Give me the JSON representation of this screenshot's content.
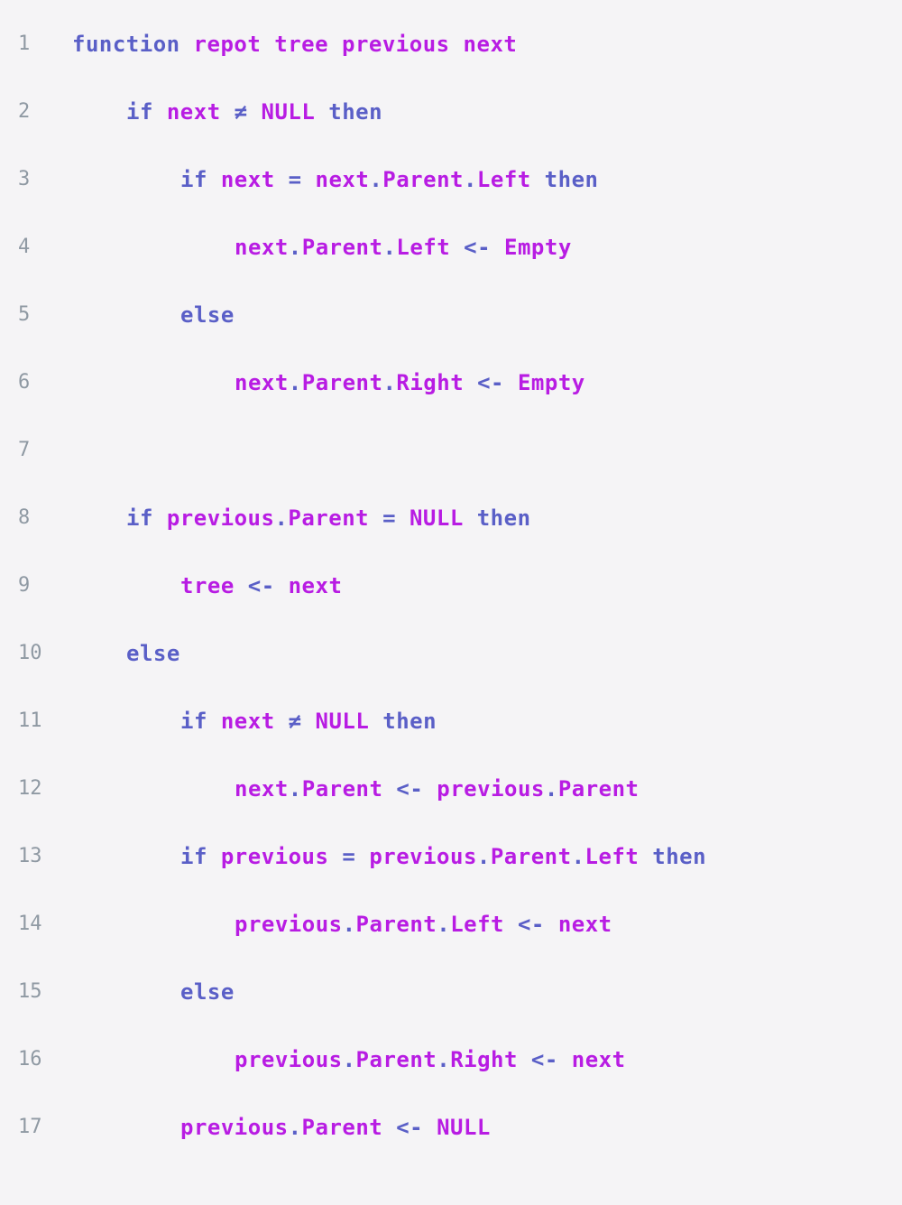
{
  "colors": {
    "background": "#f5f4f6",
    "line_number": "#8f99a3",
    "keyword": "#5a5fc7",
    "identifier": "#b81ce3",
    "operator": "#5a5fc7"
  },
  "code": {
    "lines": [
      {
        "number": "1",
        "indent": 0,
        "tokens": [
          {
            "t": "kw",
            "v": "function"
          },
          {
            "t": "ws",
            "v": " "
          },
          {
            "t": "id",
            "v": "repot"
          },
          {
            "t": "ws",
            "v": " "
          },
          {
            "t": "id",
            "v": "tree"
          },
          {
            "t": "ws",
            "v": " "
          },
          {
            "t": "id",
            "v": "previous"
          },
          {
            "t": "ws",
            "v": " "
          },
          {
            "t": "id",
            "v": "next"
          }
        ]
      },
      {
        "number": "2",
        "indent": 1,
        "tokens": [
          {
            "t": "kw",
            "v": "if"
          },
          {
            "t": "ws",
            "v": " "
          },
          {
            "t": "id",
            "v": "next"
          },
          {
            "t": "ws",
            "v": " "
          },
          {
            "t": "op",
            "v": "≠"
          },
          {
            "t": "ws",
            "v": " "
          },
          {
            "t": "id",
            "v": "NULL"
          },
          {
            "t": "ws",
            "v": " "
          },
          {
            "t": "kw",
            "v": "then"
          }
        ]
      },
      {
        "number": "3",
        "indent": 2,
        "tokens": [
          {
            "t": "kw",
            "v": "if"
          },
          {
            "t": "ws",
            "v": " "
          },
          {
            "t": "id",
            "v": "next"
          },
          {
            "t": "ws",
            "v": " "
          },
          {
            "t": "op",
            "v": "="
          },
          {
            "t": "ws",
            "v": " "
          },
          {
            "t": "id",
            "v": "next"
          },
          {
            "t": "op",
            "v": "."
          },
          {
            "t": "id",
            "v": "Parent"
          },
          {
            "t": "op",
            "v": "."
          },
          {
            "t": "id",
            "v": "Left"
          },
          {
            "t": "ws",
            "v": " "
          },
          {
            "t": "kw",
            "v": "then"
          }
        ]
      },
      {
        "number": "4",
        "indent": 3,
        "tokens": [
          {
            "t": "id",
            "v": "next"
          },
          {
            "t": "op",
            "v": "."
          },
          {
            "t": "id",
            "v": "Parent"
          },
          {
            "t": "op",
            "v": "."
          },
          {
            "t": "id",
            "v": "Left"
          },
          {
            "t": "ws",
            "v": " "
          },
          {
            "t": "op",
            "v": "<-"
          },
          {
            "t": "ws",
            "v": " "
          },
          {
            "t": "id",
            "v": "Empty"
          }
        ]
      },
      {
        "number": "5",
        "indent": 2,
        "tokens": [
          {
            "t": "kw",
            "v": "else"
          }
        ]
      },
      {
        "number": "6",
        "indent": 3,
        "tokens": [
          {
            "t": "id",
            "v": "next"
          },
          {
            "t": "op",
            "v": "."
          },
          {
            "t": "id",
            "v": "Parent"
          },
          {
            "t": "op",
            "v": "."
          },
          {
            "t": "id",
            "v": "Right"
          },
          {
            "t": "ws",
            "v": " "
          },
          {
            "t": "op",
            "v": "<-"
          },
          {
            "t": "ws",
            "v": " "
          },
          {
            "t": "id",
            "v": "Empty"
          }
        ]
      },
      {
        "number": "7",
        "indent": 0,
        "tokens": []
      },
      {
        "number": "8",
        "indent": 1,
        "tokens": [
          {
            "t": "kw",
            "v": "if"
          },
          {
            "t": "ws",
            "v": " "
          },
          {
            "t": "id",
            "v": "previous"
          },
          {
            "t": "op",
            "v": "."
          },
          {
            "t": "id",
            "v": "Parent"
          },
          {
            "t": "ws",
            "v": " "
          },
          {
            "t": "op",
            "v": "="
          },
          {
            "t": "ws",
            "v": " "
          },
          {
            "t": "id",
            "v": "NULL"
          },
          {
            "t": "ws",
            "v": " "
          },
          {
            "t": "kw",
            "v": "then"
          }
        ]
      },
      {
        "number": "9",
        "indent": 2,
        "tokens": [
          {
            "t": "id",
            "v": "tree"
          },
          {
            "t": "ws",
            "v": " "
          },
          {
            "t": "op",
            "v": "<-"
          },
          {
            "t": "ws",
            "v": " "
          },
          {
            "t": "id",
            "v": "next"
          }
        ]
      },
      {
        "number": "10",
        "indent": 1,
        "tokens": [
          {
            "t": "kw",
            "v": "else"
          }
        ]
      },
      {
        "number": "11",
        "indent": 2,
        "tokens": [
          {
            "t": "kw",
            "v": "if"
          },
          {
            "t": "ws",
            "v": " "
          },
          {
            "t": "id",
            "v": "next"
          },
          {
            "t": "ws",
            "v": " "
          },
          {
            "t": "op",
            "v": "≠"
          },
          {
            "t": "ws",
            "v": " "
          },
          {
            "t": "id",
            "v": "NULL"
          },
          {
            "t": "ws",
            "v": " "
          },
          {
            "t": "kw",
            "v": "then"
          }
        ]
      },
      {
        "number": "12",
        "indent": 3,
        "tokens": [
          {
            "t": "id",
            "v": "next"
          },
          {
            "t": "op",
            "v": "."
          },
          {
            "t": "id",
            "v": "Parent"
          },
          {
            "t": "ws",
            "v": " "
          },
          {
            "t": "op",
            "v": "<-"
          },
          {
            "t": "ws",
            "v": " "
          },
          {
            "t": "id",
            "v": "previous"
          },
          {
            "t": "op",
            "v": "."
          },
          {
            "t": "id",
            "v": "Parent"
          }
        ]
      },
      {
        "number": "13",
        "indent": 2,
        "tokens": [
          {
            "t": "kw",
            "v": "if"
          },
          {
            "t": "ws",
            "v": " "
          },
          {
            "t": "id",
            "v": "previous"
          },
          {
            "t": "ws",
            "v": " "
          },
          {
            "t": "op",
            "v": "="
          },
          {
            "t": "ws",
            "v": " "
          },
          {
            "t": "id",
            "v": "previous"
          },
          {
            "t": "op",
            "v": "."
          },
          {
            "t": "id",
            "v": "Parent"
          },
          {
            "t": "op",
            "v": "."
          },
          {
            "t": "id",
            "v": "Left"
          },
          {
            "t": "ws",
            "v": " "
          },
          {
            "t": "kw",
            "v": "then"
          }
        ]
      },
      {
        "number": "14",
        "indent": 3,
        "tokens": [
          {
            "t": "id",
            "v": "previous"
          },
          {
            "t": "op",
            "v": "."
          },
          {
            "t": "id",
            "v": "Parent"
          },
          {
            "t": "op",
            "v": "."
          },
          {
            "t": "id",
            "v": "Left"
          },
          {
            "t": "ws",
            "v": " "
          },
          {
            "t": "op",
            "v": "<-"
          },
          {
            "t": "ws",
            "v": " "
          },
          {
            "t": "id",
            "v": "next"
          }
        ]
      },
      {
        "number": "15",
        "indent": 2,
        "tokens": [
          {
            "t": "kw",
            "v": "else"
          }
        ]
      },
      {
        "number": "16",
        "indent": 3,
        "tokens": [
          {
            "t": "id",
            "v": "previous"
          },
          {
            "t": "op",
            "v": "."
          },
          {
            "t": "id",
            "v": "Parent"
          },
          {
            "t": "op",
            "v": "."
          },
          {
            "t": "id",
            "v": "Right"
          },
          {
            "t": "ws",
            "v": " "
          },
          {
            "t": "op",
            "v": "<-"
          },
          {
            "t": "ws",
            "v": " "
          },
          {
            "t": "id",
            "v": "next"
          }
        ]
      },
      {
        "number": "17",
        "indent": 2,
        "tokens": [
          {
            "t": "id",
            "v": "previous"
          },
          {
            "t": "op",
            "v": "."
          },
          {
            "t": "id",
            "v": "Parent"
          },
          {
            "t": "ws",
            "v": " "
          },
          {
            "t": "op",
            "v": "<-"
          },
          {
            "t": "ws",
            "v": " "
          },
          {
            "t": "id",
            "v": "NULL"
          }
        ]
      }
    ]
  }
}
